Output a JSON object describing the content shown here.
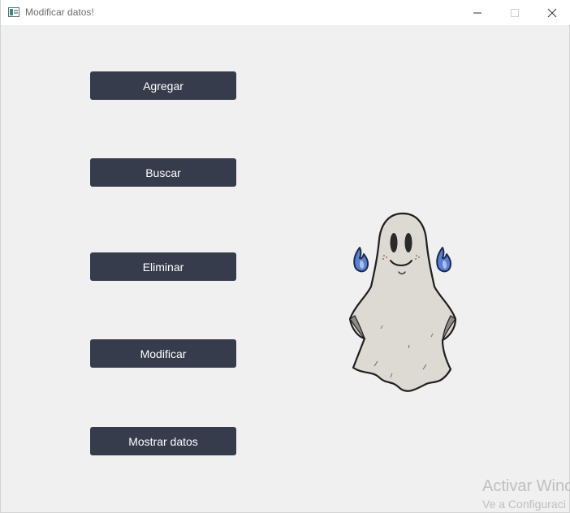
{
  "window": {
    "title": "Modificar datos!"
  },
  "icons": {
    "app": "app-window-icon",
    "minimize": "minimize-icon",
    "maximize": "maximize-icon",
    "close": "close-icon"
  },
  "buttons": {
    "agregar": "Agregar",
    "buscar": "Buscar",
    "eliminar": "Eliminar",
    "modificar": "Modificar",
    "mostrar": "Mostrar datos"
  },
  "colors": {
    "button_bg": "#373c4d",
    "button_text": "#ffffff",
    "window_bg": "#f0f0f0"
  },
  "watermark": {
    "line1": "Activar Winc",
    "line2": "Ve a Configuraci"
  }
}
